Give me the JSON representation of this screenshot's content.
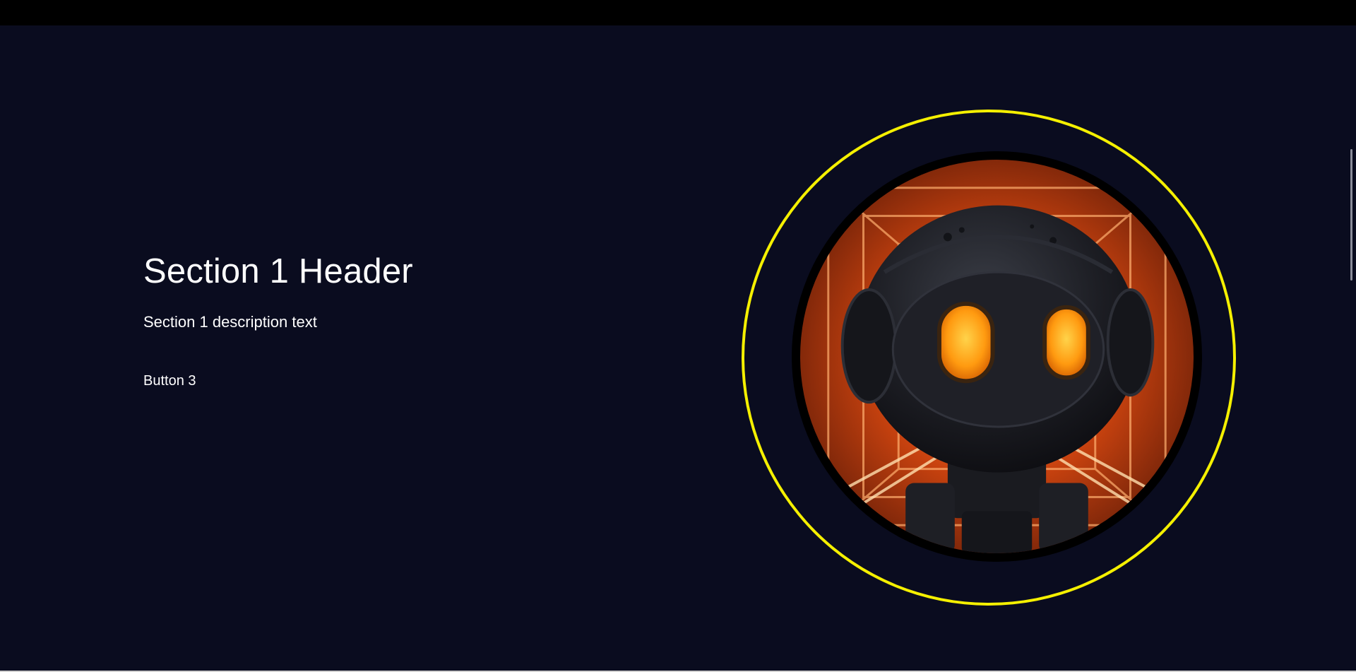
{
  "section": {
    "header": "Section 1 Header",
    "description": "Section 1 description text",
    "button_label": "Button 3"
  },
  "hero_image": {
    "icon": "robot-avatar-image",
    "ring_color": "#f5f000"
  },
  "colors": {
    "background": "#0a0c1f",
    "topbar": "#000000",
    "text": "#ffffff",
    "glow": "#ff7a1a"
  }
}
